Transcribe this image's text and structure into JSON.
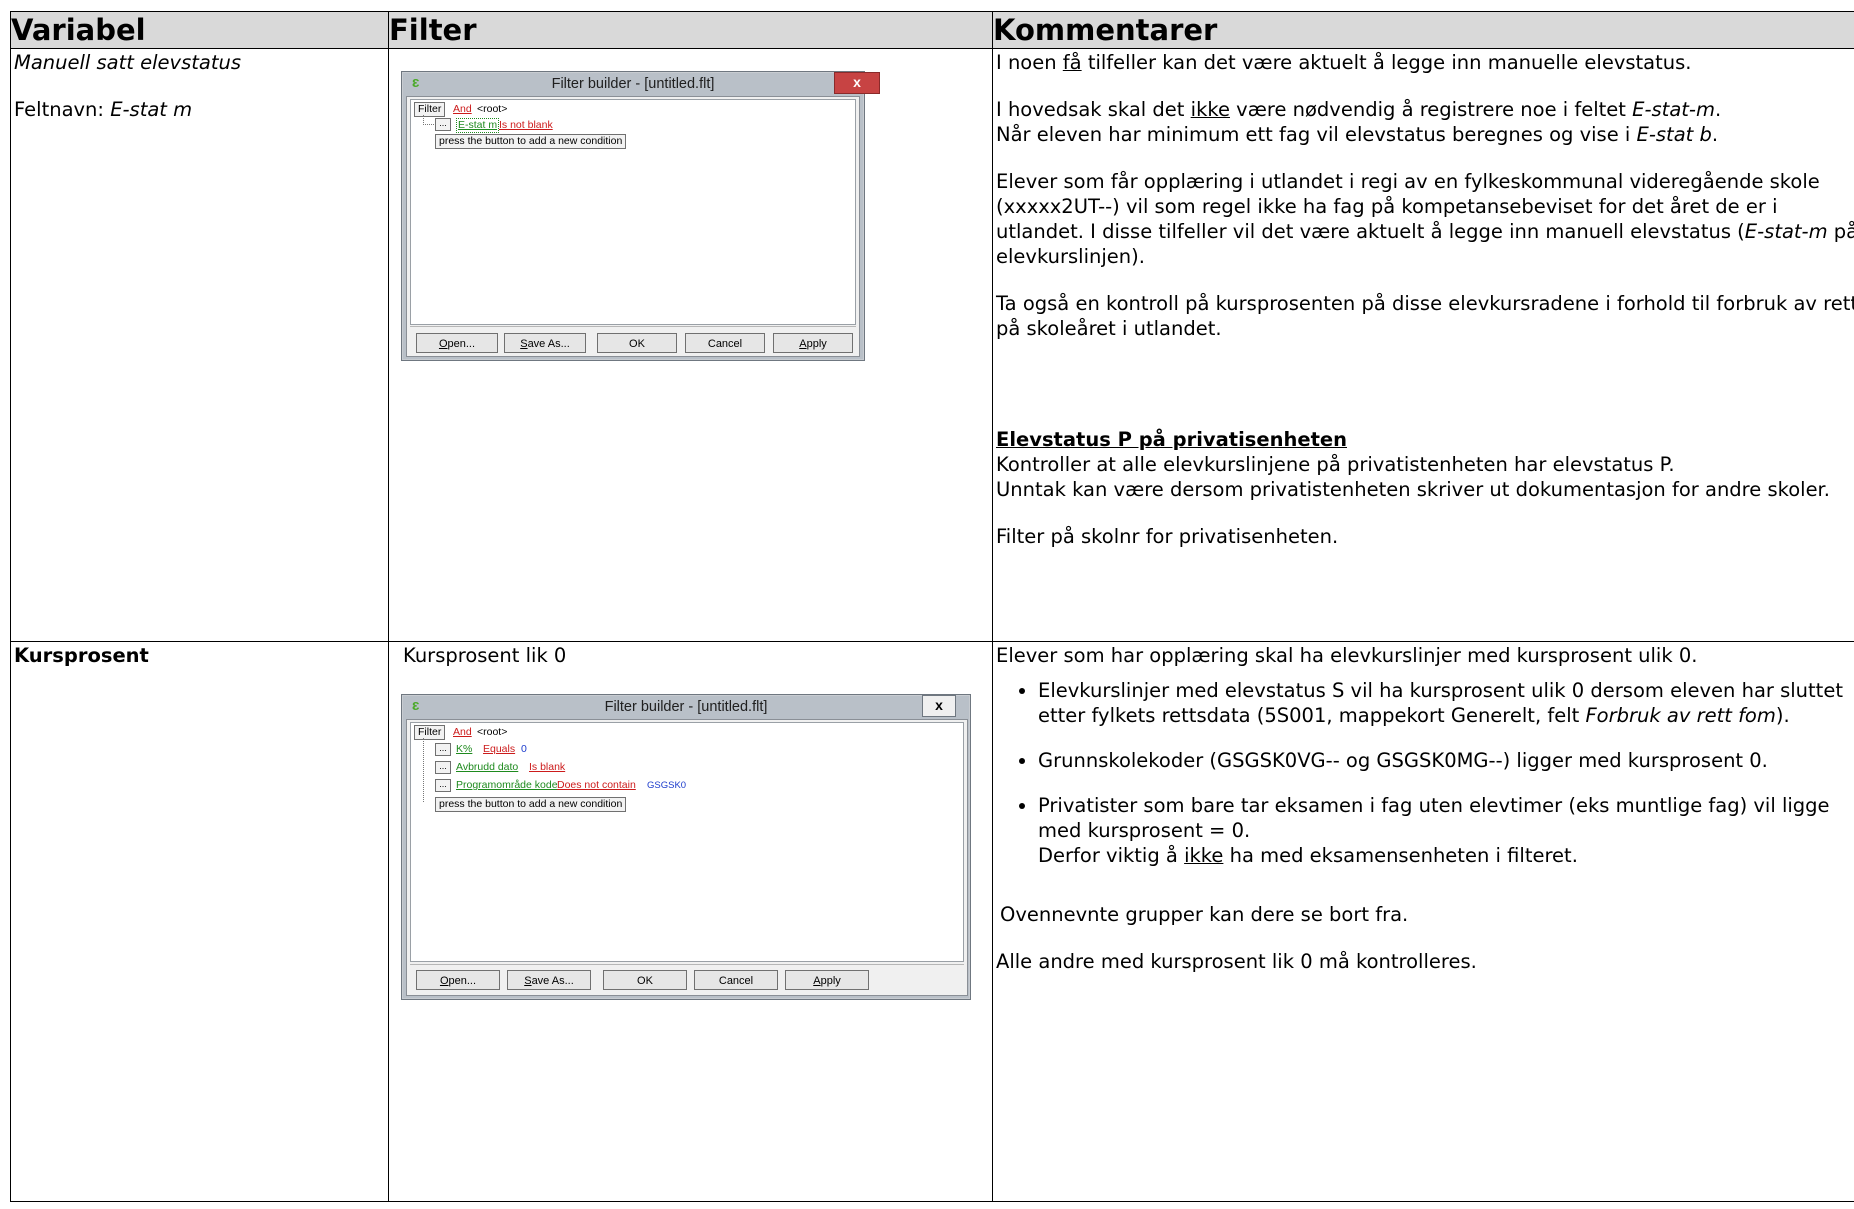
{
  "headers": {
    "variable": "Variabel",
    "filter": "Filter",
    "comments": "Kommentarer"
  },
  "row1": {
    "variable_title": "Manuell satt elevstatus",
    "field_label": "Feltnavn: ",
    "field_name": "E-stat m",
    "dialog": {
      "title": "Filter builder - [untitled.flt]",
      "close": "x",
      "root_filter": "Filter",
      "root_and": "And",
      "root_label": "<root>",
      "ellipsis": "...",
      "cond_field": "E-stat m",
      "cond_op": "Is not blank",
      "add_hint": "press the button to add a new condition",
      "buttons": [
        "Open...",
        "Save As...",
        "OK",
        "Cancel",
        "Apply"
      ]
    },
    "comments": {
      "p1_pre": "I noen ",
      "p1_u": "få",
      "p1_post": " tilfeller kan det være aktuelt å legge inn manuelle elevstatus.",
      "p2_a": "I hovedsak skal det ",
      "p2_u": "ikke",
      "p2_b": " være nødvendig å registrere noe i feltet ",
      "p2_i1": "E-stat-m",
      "p2_c": ".",
      "p2_d": "Når eleven har minimum ett fag vil elevstatus beregnes og vise i ",
      "p2_i2": "E-stat b",
      "p2_e": ".",
      "p3_a": "Elever som får opplæring i utlandet i regi av en fylkeskommunal videregående skole (xxxxx2UT--) vil som regel ikke ha fag på kompetansebeviset for det året de er i utlandet. I disse tilfeller vil det være aktuelt å legge inn manuell elevstatus (",
      "p3_i": "E-stat-m",
      "p3_b": " på elevkurslinjen).",
      "p4": "Ta også en kontroll på kursprosenten på disse elevkursradene i forhold til forbruk av rett på skoleåret i utlandet.",
      "heading": "Elevstatus P på privatisenheten",
      "p5": "Kontroller at alle elevkurslinjene på privatistenheten har elevstatus P.",
      "p6": "Unntak kan være dersom privatistenheten skriver ut dokumentasjon for andre skoler.",
      "p7": "Filter på skolnr for privatisenheten."
    }
  },
  "row2": {
    "variable_title": "Kursprosent",
    "filter_caption": "Kursprosent lik 0",
    "dialog": {
      "title": "Filter builder - [untitled.flt]",
      "close": "x",
      "root_filter": "Filter",
      "root_and": "And",
      "root_label": "<root>",
      "ellipsis": "...",
      "c1_field": "K%",
      "c1_op": "Equals",
      "c1_val": "0",
      "c2_field": "Avbrudd dato",
      "c2_op": "Is blank",
      "c3_field": "Programområde kode",
      "c3_op": "Does not contain",
      "c3_val": "GSGSK0",
      "add_hint": "press the button to add a new condition",
      "buttons": [
        "Open...",
        "Save As...",
        "OK",
        "Cancel",
        "Apply"
      ]
    },
    "comments": {
      "intro": "Elever som har opplæring skal ha elevkurslinjer med kursprosent ulik 0.",
      "b1_a": "Elevkurslinjer med elevstatus S vil ha kursprosent ulik 0 dersom eleven har sluttet etter fylkets rettsdata (5S001, mappekort Generelt, felt ",
      "b1_i": "Forbruk av rett fom",
      "b1_b": ").",
      "b2": "Grunnskolekoder (GSGSK0VG-- og GSGSK0MG--) ligger med kursprosent 0.",
      "b3_a": "Privatister som bare tar eksamen i fag uten elevtimer (eks muntlige fag) vil ligge med kursprosent = 0.",
      "b3_b": "Derfor viktig å ",
      "b3_u": "ikke",
      "b3_c": " ha med eksamensenheten i filteret.",
      "p_after": "Ovennevnte grupper kan dere se bort fra.",
      "p_last": "Alle andre med kursprosent lik 0 må kontrolleres."
    }
  },
  "colors": {
    "header_bg": "#d9d9d9",
    "dialog_frame": "#b9c0c8",
    "red": "#cc1b1b",
    "green": "#1e8a1e",
    "blue": "#1b3bcc"
  }
}
